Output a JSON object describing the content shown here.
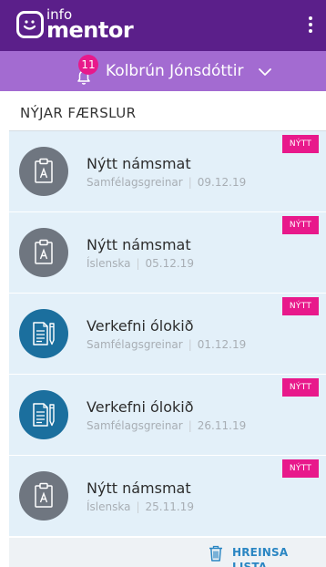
{
  "header": {
    "logo_info": "info",
    "logo_mentor": "mentor",
    "menu_icon": "kebab-menu-icon"
  },
  "user": {
    "notification_count": "11",
    "name": "Kolbrún Jónsdóttir",
    "bell_icon": "bell-icon",
    "chevron_icon": "chevron-down-icon"
  },
  "section": {
    "title": "NÝJAR FÆRSLUR"
  },
  "items": [
    {
      "badge": "NÝTT",
      "title": "Nýtt námsmat",
      "subject": "Samfélagsgreinar",
      "date": "09.12.19",
      "icon": "assessment-clipboard-icon",
      "icon_color": "#6f7680"
    },
    {
      "badge": "NÝTT",
      "title": "Nýtt námsmat",
      "subject": "Íslenska",
      "date": "05.12.19",
      "icon": "assessment-clipboard-icon",
      "icon_color": "#6f7680"
    },
    {
      "badge": "NÝTT",
      "title": "Verkefni ólokið",
      "subject": "Samfélagsgreinar",
      "date": "01.12.19",
      "icon": "assignment-document-icon",
      "icon_color": "#1b6f9e"
    },
    {
      "badge": "NÝTT",
      "title": "Verkefni ólokið",
      "subject": "Samfélagsgreinar",
      "date": "26.11.19",
      "icon": "assignment-document-icon",
      "icon_color": "#1b6f9e"
    },
    {
      "badge": "NÝTT",
      "title": "Nýtt námsmat",
      "subject": "Íslenska",
      "date": "25.11.19",
      "icon": "assessment-clipboard-icon",
      "icon_color": "#6f7680"
    }
  ],
  "footer": {
    "clear_label": "HREINSA LISTA",
    "trash_icon": "trash-icon"
  },
  "colors": {
    "topbar": "#5b1f8a",
    "userbar": "#a36bd1",
    "badge": "#e8198b",
    "item_bg": "#e3f0f9",
    "accent": "#2a86c3"
  }
}
